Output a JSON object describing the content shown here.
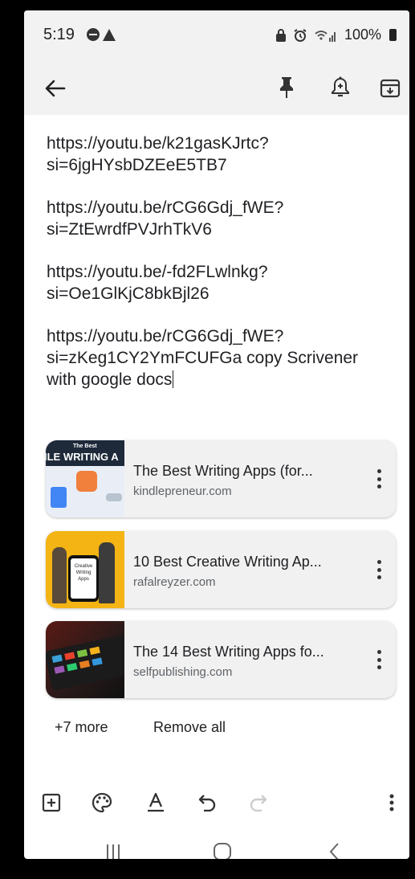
{
  "status_bar": {
    "time": "5:19",
    "battery": "100%"
  },
  "toolbar": {
    "icons": [
      "back-arrow-icon",
      "pin-icon",
      "reminder-bell-icon",
      "archive-icon"
    ]
  },
  "note": {
    "paragraphs": [
      "https://youtu.be/k21gasKJrtc?si=6jgHYsbDZEeE5TB7",
      "https://youtu.be/rCG6Gdj_fWE?si=ZtEwrdfPVJrhTkV6",
      "https://youtu.be/-fd2FLwlnkg?si=Oe1GlKjC8bkBjl26",
      "https://youtu.be/rCG6Gdj_fWE?si=zKeg1CY2YmFCUFGa copy Scrivener with google docs"
    ]
  },
  "link_cards": [
    {
      "title": "The Best Writing Apps (for...",
      "domain": "kindlepreneur.com",
      "thumb_text": "ILE WRITING A",
      "thumb_small": "The Best"
    },
    {
      "title": "10 Best Creative Writing Ap...",
      "domain": "rafalreyzer.com",
      "thumb_text": "Creative Writing Apps"
    },
    {
      "title": "The 14 Best Writing Apps fo...",
      "domain": "selfpublishing.com"
    }
  ],
  "more_links": {
    "more_label": "+7 more",
    "remove_label": "Remove all"
  },
  "bottom_toolbar": {
    "icons": [
      "add-box-icon",
      "palette-icon",
      "text-format-icon",
      "undo-icon",
      "redo-icon",
      "more-vert-icon"
    ]
  },
  "nav_bar": {
    "icons": [
      "recents-icon",
      "home-icon",
      "back-icon"
    ]
  },
  "colors": {
    "topbar_bg": "#f2f2f2",
    "card_bg": "#f1f1f1",
    "text": "#202124",
    "subtext": "#5f6368"
  }
}
